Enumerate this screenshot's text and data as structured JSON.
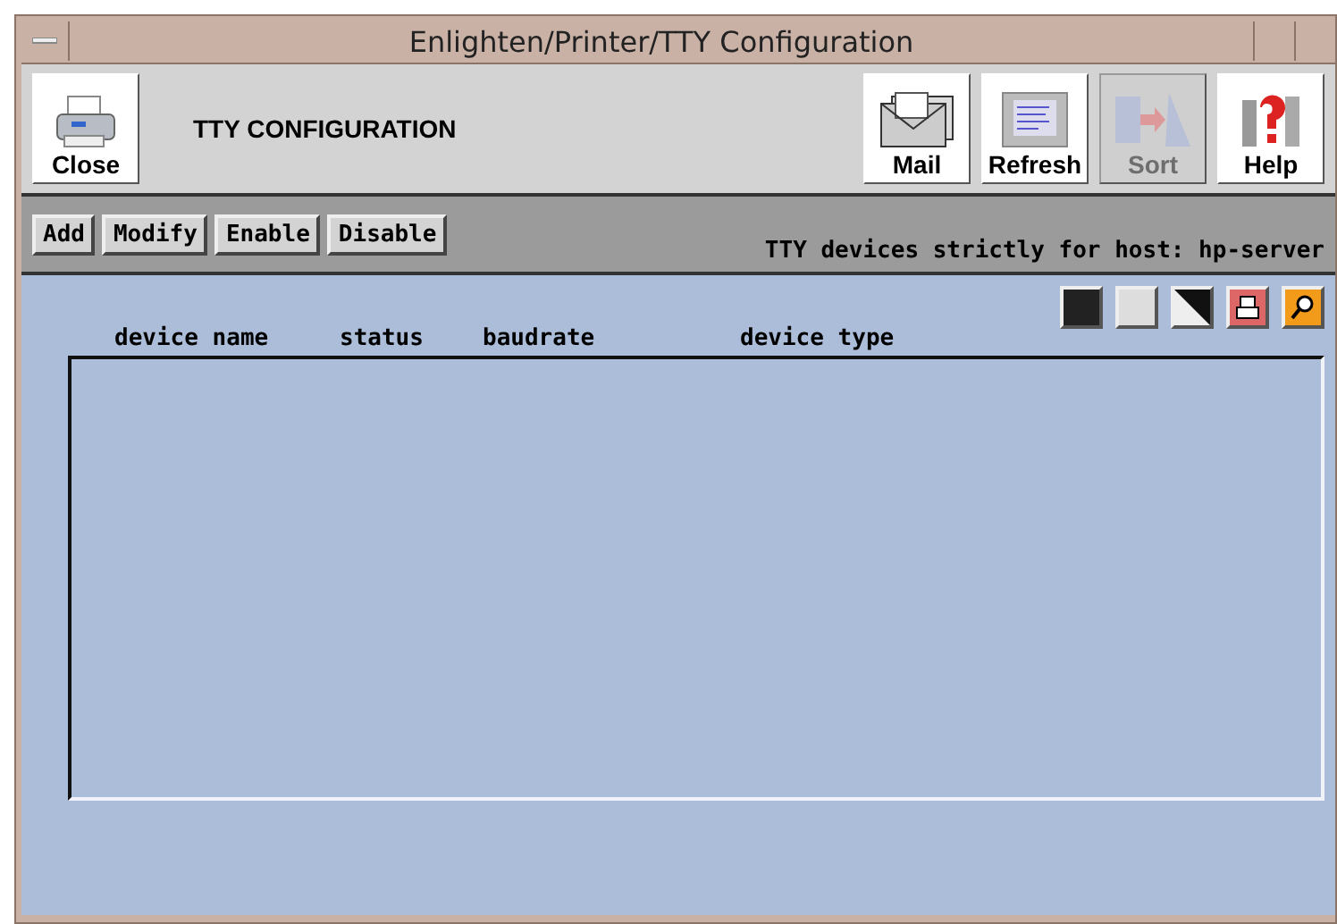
{
  "window": {
    "title": "Enlighten/Printer/TTY Configuration"
  },
  "header": {
    "title": "TTY CONFIGURATION"
  },
  "toolbar_left": [
    {
      "label": "Close",
      "kind": "printer",
      "disabled": false
    }
  ],
  "toolbar_right": [
    {
      "label": "Mail",
      "kind": "mail",
      "disabled": false
    },
    {
      "label": "Refresh",
      "kind": "refresh",
      "disabled": false
    },
    {
      "label": "Sort",
      "kind": "sort",
      "disabled": true
    },
    {
      "label": "Help",
      "kind": "help",
      "disabled": false
    }
  ],
  "actions": [
    "Add",
    "Modify",
    "Enable",
    "Disable"
  ],
  "host_note": "TTY devices strictly for host: hp-server",
  "view_buttons": [
    {
      "kind": "dark"
    },
    {
      "kind": "light"
    },
    {
      "kind": "split"
    },
    {
      "kind": "print"
    },
    {
      "kind": "zoom"
    }
  ],
  "table": {
    "columns": [
      "device name",
      "status",
      "baudrate",
      "device type"
    ]
  }
}
